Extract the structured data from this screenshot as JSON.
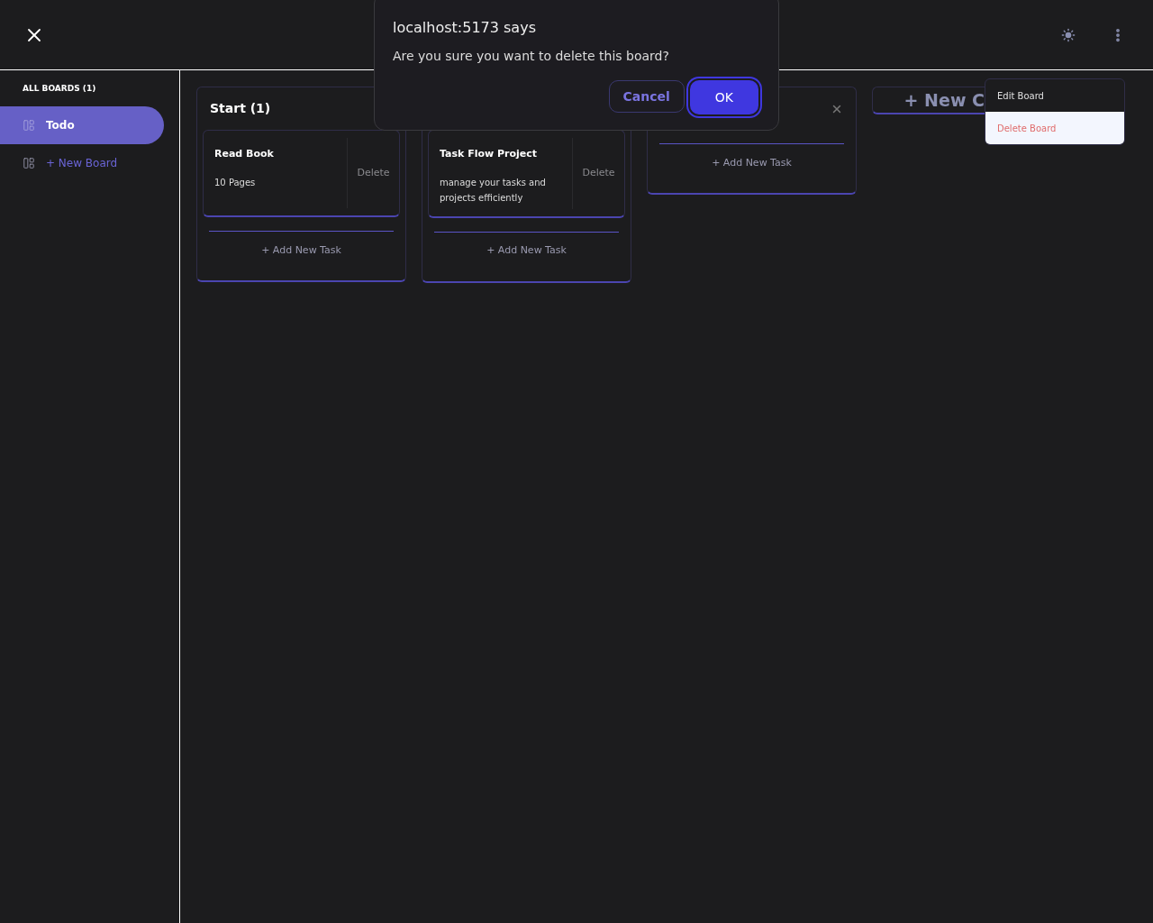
{
  "sidebar": {
    "heading": "ALL BOARDS (1)",
    "items": [
      {
        "label": "Todo",
        "selected": true
      }
    ],
    "new_board": "+ New Board"
  },
  "columns": [
    {
      "title": "Start (1)",
      "tasks": [
        {
          "title": "Read Book",
          "description": "10 Pages",
          "delete": "Delete"
        }
      ],
      "add_task": "+ Add New Task"
    },
    {
      "tasks": [
        {
          "title": "Task Flow Project",
          "description": "manage your tasks and projects efficiently",
          "delete": "Delete"
        }
      ],
      "add_task": "+ Add New Task"
    },
    {
      "close": true,
      "add_task": "+ Add New Task"
    }
  ],
  "new_column": "+ New C",
  "menu": {
    "items": [
      {
        "label": "Edit Board",
        "kind": "normal",
        "selected": false
      },
      {
        "label": "Delete Board",
        "kind": "danger",
        "selected": true
      }
    ]
  },
  "dialog": {
    "title": "localhost:5173 says",
    "message": "Are you sure you want to delete this board?",
    "buttons": [
      {
        "label": "Cancel",
        "kind": "secondary"
      },
      {
        "label": "OK",
        "kind": "primary"
      }
    ]
  }
}
